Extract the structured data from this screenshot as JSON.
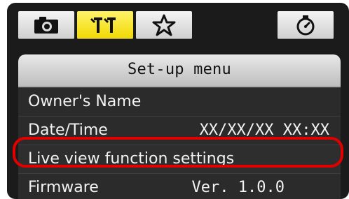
{
  "tabs": [
    {
      "name": "camera",
      "icon": "camera-icon",
      "active": false
    },
    {
      "name": "setup",
      "icon": "wrench-tools-icon",
      "active": true
    },
    {
      "name": "my-menu",
      "icon": "star-icon",
      "active": false
    },
    {
      "name": "timer",
      "icon": "stopwatch-icon",
      "active": false
    }
  ],
  "menu": {
    "title": "Set-up menu",
    "items": [
      {
        "label": "Owner's Name",
        "value": ""
      },
      {
        "label": "Date/Time",
        "value": "XX/XX/XX XX:XX"
      },
      {
        "label": "Live view function settings",
        "value": ""
      },
      {
        "label": "Firmware",
        "value": "Ver. 1.0.0"
      }
    ]
  },
  "colors": {
    "background": "#1b1b1b",
    "tab_inactive": "#dcdcdc",
    "tab_active": "#f6e200",
    "text": "#f2f2f2",
    "highlight_ring": "#e00000"
  }
}
